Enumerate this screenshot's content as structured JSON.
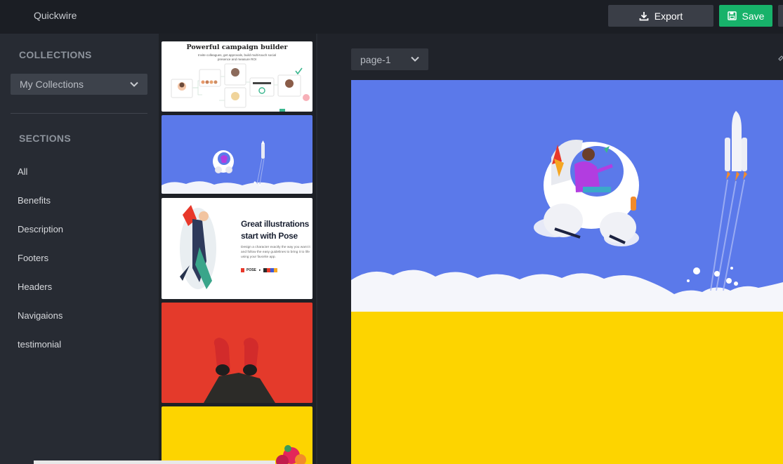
{
  "app": {
    "title": "Quickwire"
  },
  "toolbar": {
    "export_label": "Export",
    "save_label": "Save"
  },
  "sidebar": {
    "collections_heading": "COLLECTIONS",
    "collections_selected": "My Collections",
    "sections_heading": "SECTIONS",
    "items": [
      {
        "label": "All"
      },
      {
        "label": "Benefits"
      },
      {
        "label": "Description"
      },
      {
        "label": "Footers"
      },
      {
        "label": "Headers"
      },
      {
        "label": "Navigaions"
      },
      {
        "label": "testimonial"
      }
    ]
  },
  "thumbnails": {
    "t1": {
      "title": "Powerful campaign builder",
      "subtitle_1": "Invite colleagues, get approvals, build multi-touch social",
      "subtitle_2": "presence and measure ROI"
    },
    "t3": {
      "title_1": "Great illustrations",
      "title_2": "start with Pose",
      "body_1": "Design a character exactly the way you want it",
      "body_2": "and follow the easy guidelines to bring it to life",
      "body_3": "using your favorite app.",
      "brand": "POSE"
    }
  },
  "main": {
    "page_selected": "page-1"
  },
  "colors": {
    "accent_save": "#17b26a",
    "sky": "#5b79ea",
    "yellow": "#fdd400",
    "red": "#e8382a"
  }
}
